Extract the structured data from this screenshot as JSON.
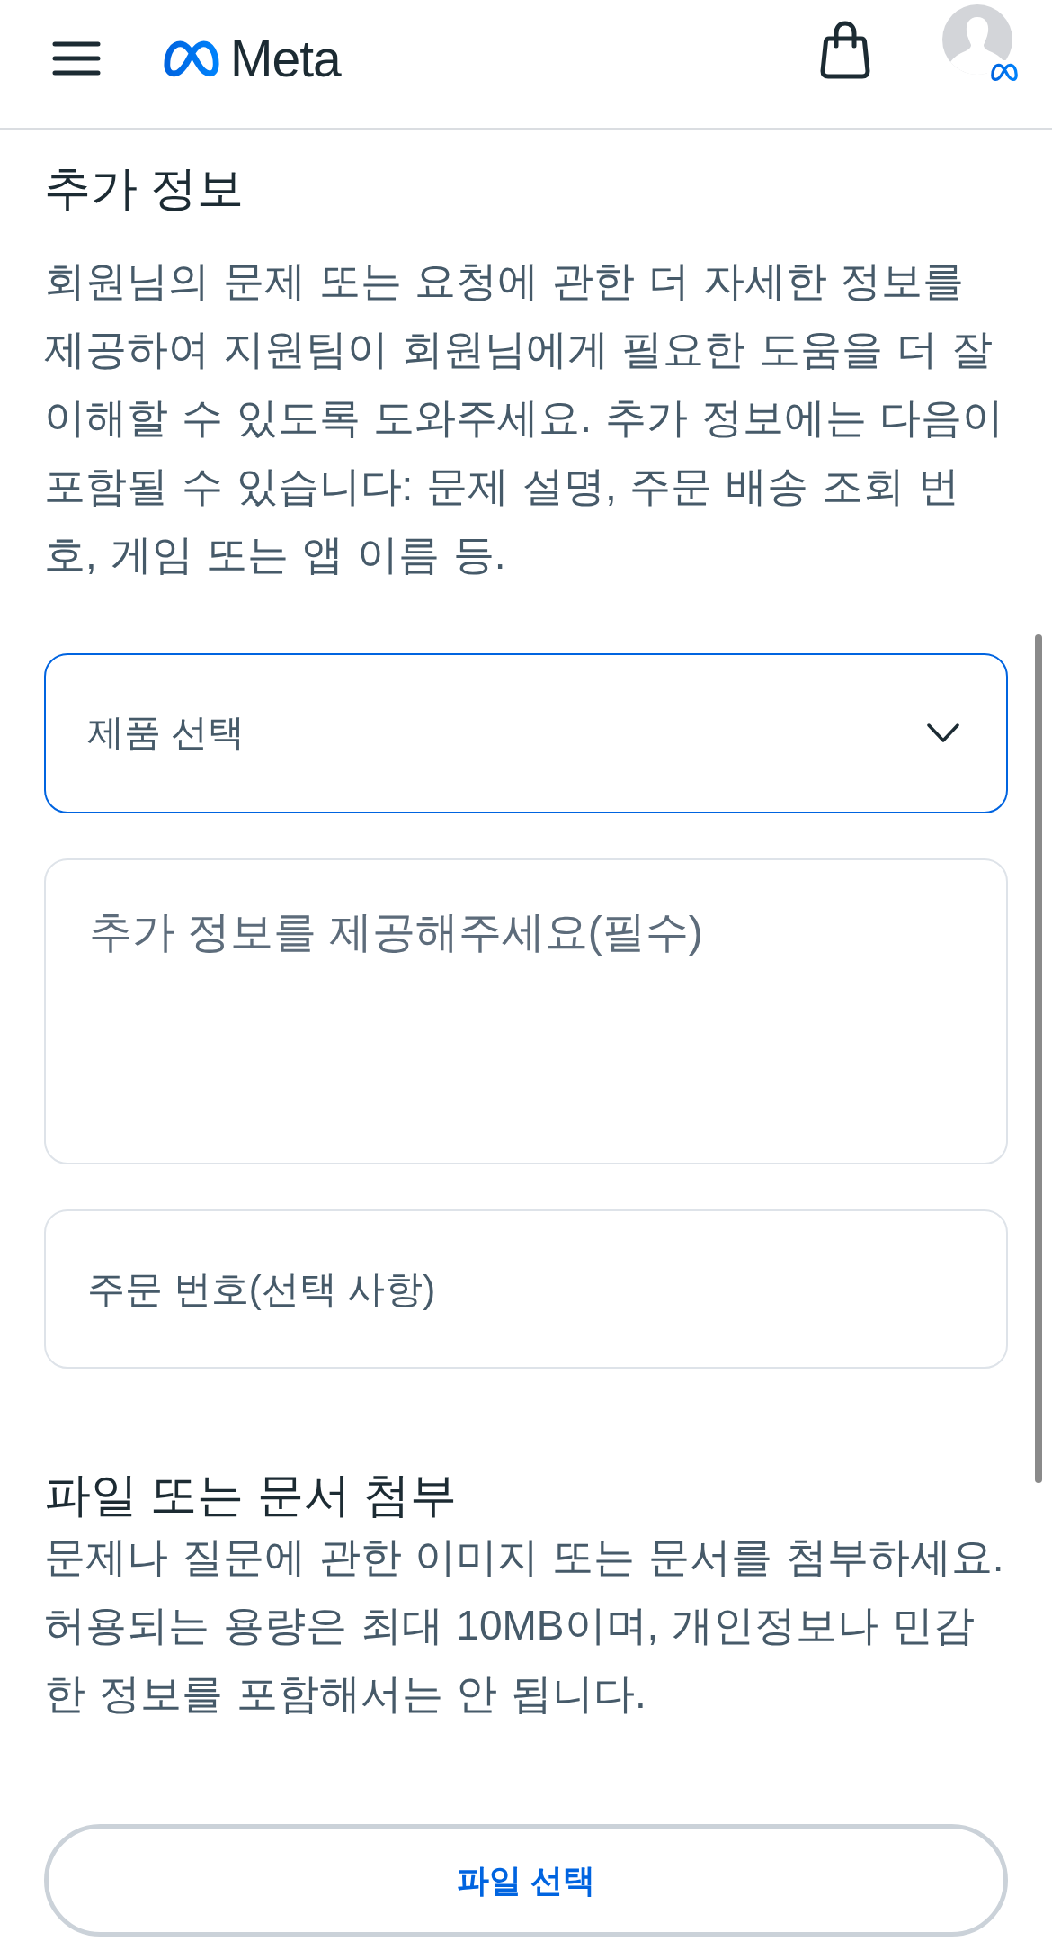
{
  "header": {
    "logo_text": "Meta"
  },
  "additional_info": {
    "title": "추가 정보",
    "description": "회원님의 문제 또는 요청에 관한 더 자세한 정보를 제공하여 지원팀이 회원님에게 필요한 도움을 더 잘 이해할 수 있도록 도와주세요. 추가 정보에는 다음이 포함될 수 있습니다: 문제 설명, 주문 배송 조회 번호, 게임 또는 앱 이름 등."
  },
  "product_select": {
    "label": "제품 선택",
    "focused": true
  },
  "details_field": {
    "placeholder": "추가 정보를 제공해주세요(필수)"
  },
  "order_number_field": {
    "placeholder": "주문 번호(선택 사항)"
  },
  "attachment": {
    "title": "파일 또는 문서 첨부",
    "description": "문제나 질문에 관한 이미지 또는 문서를 첨부하세요. 허용되는 용량은 최대 10MB이며, 개인정보나 민감한 정보를 포함해서는 안 됩니다.",
    "button": "파일 선택"
  }
}
